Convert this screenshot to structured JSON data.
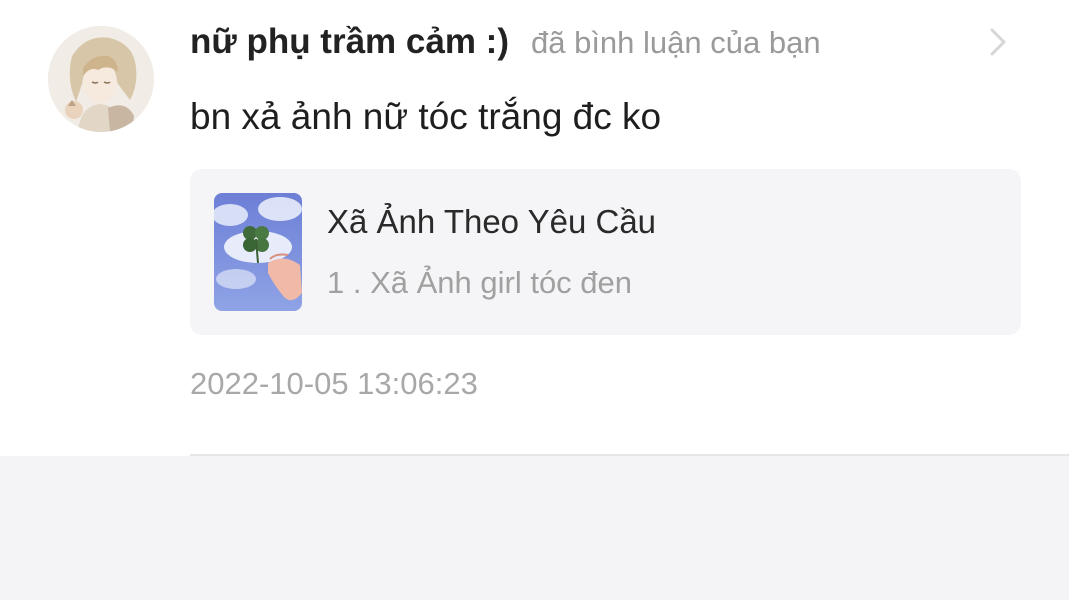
{
  "notification": {
    "username": "nữ phụ trầm cảm :)",
    "action": "đã bình luận của bạn",
    "comment": "bn xả ảnh nữ tóc trắng đc ko",
    "post": {
      "title": "Xã Ảnh Theo Yêu Cầu",
      "subtitle": "1 . Xã Ảnh girl tóc đen"
    },
    "timestamp": "2022-10-05 13:06:23"
  },
  "icons": {
    "chevron": "chevron-right-icon",
    "avatar": "anime-girl-avatar",
    "thumbnail": "four-leaf-clover-sky-thumbnail"
  },
  "colors": {
    "username": "#222222",
    "secondary_text": "#9a9a9a",
    "card_background": "#f5f5f7",
    "page_background": "#f4f4f6"
  }
}
